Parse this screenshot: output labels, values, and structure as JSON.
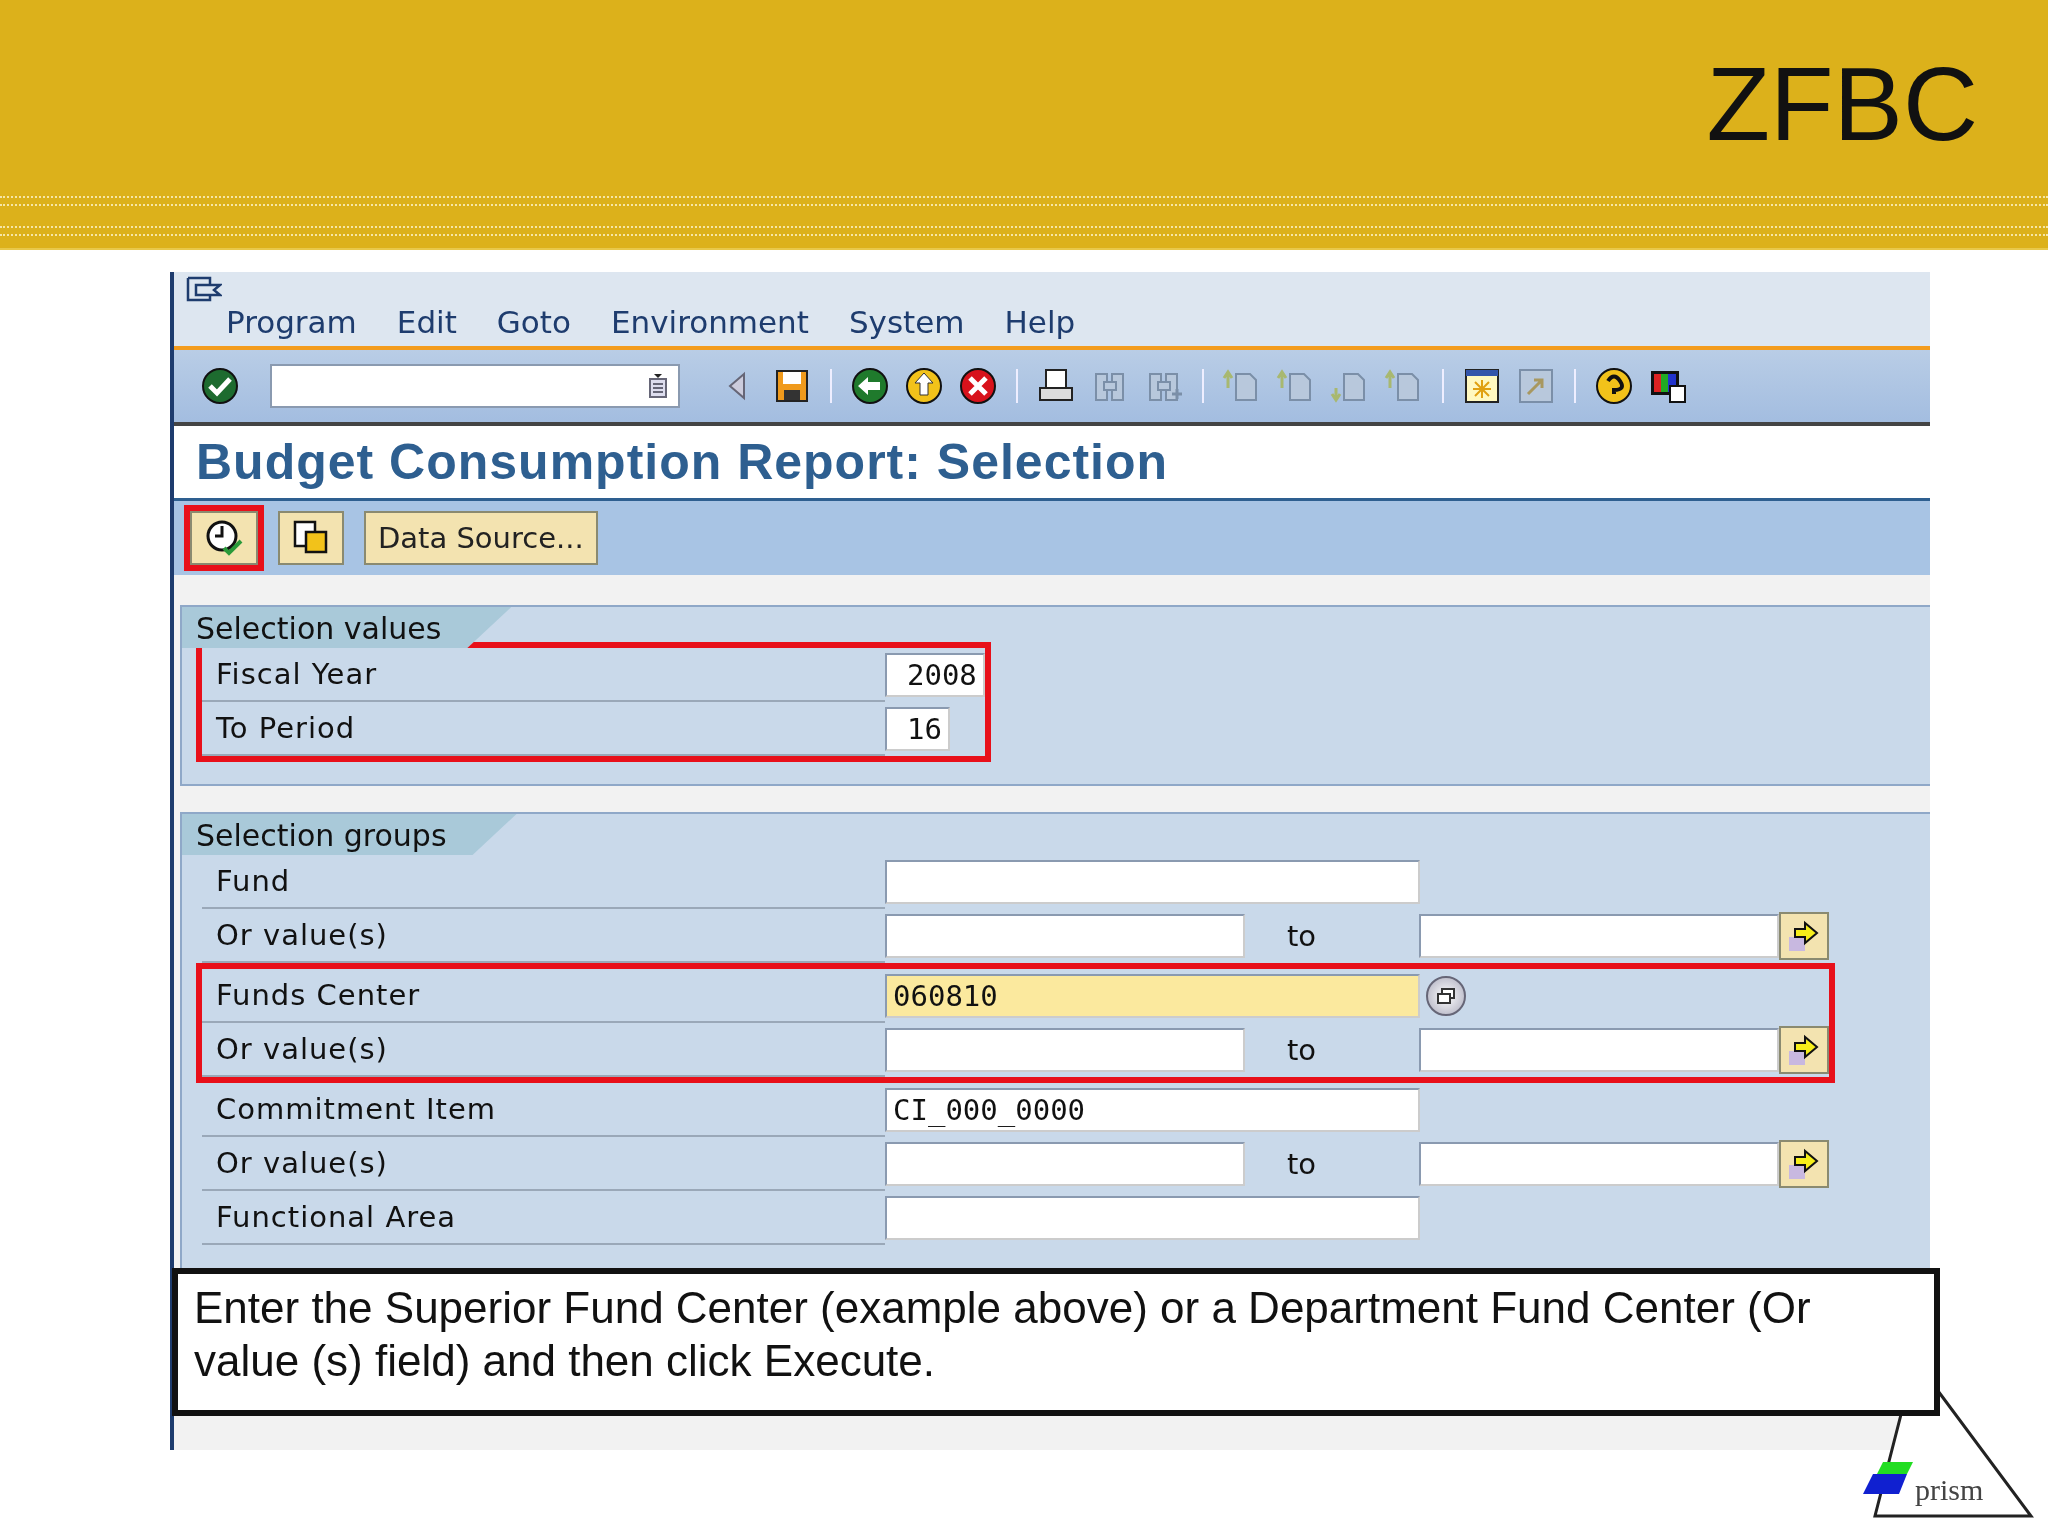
{
  "slide": {
    "title": "ZFBC",
    "caption": "Enter the Superior Fund Center (example above) or a Department Fund Center (Or value (s) field) and then click Execute.",
    "logo": "prism"
  },
  "menu": [
    "Program",
    "Edit",
    "Goto",
    "Environment",
    "System",
    "Help"
  ],
  "screen_title": "Budget Consumption Report: Selection",
  "app_toolbar": [
    {
      "kind": "execute",
      "highlighted": true
    },
    {
      "kind": "variant",
      "highlighted": false
    },
    {
      "kind": "text",
      "label": "Data Source...",
      "highlighted": false
    }
  ],
  "sections": [
    {
      "title": "Selection values",
      "groups": [
        {
          "highlighted": true,
          "rows": [
            {
              "kind": "param",
              "label": "Fiscal Year",
              "value": "2008"
            },
            {
              "kind": "param",
              "label": "To Period",
              "value": "16"
            }
          ]
        }
      ]
    },
    {
      "title": "Selection groups",
      "groups": [
        {
          "highlighted": false,
          "rows": [
            {
              "kind": "single",
              "label": "Fund",
              "value": "",
              "focused": false
            },
            {
              "kind": "range",
              "label": "Or value(s)",
              "to": "to"
            }
          ]
        },
        {
          "highlighted": true,
          "rows": [
            {
              "kind": "single",
              "label": "Funds Center",
              "value": "060810",
              "focused": true
            },
            {
              "kind": "range",
              "label": "Or value(s)",
              "to": "to"
            }
          ]
        },
        {
          "highlighted": false,
          "rows": [
            {
              "kind": "single",
              "label": "Commitment Item",
              "value": "CI_000_0000",
              "focused": false
            },
            {
              "kind": "range",
              "label": "Or value(s)",
              "to": "to"
            },
            {
              "kind": "single",
              "label": "Functional Area",
              "value": "",
              "focused": false
            }
          ]
        }
      ]
    }
  ]
}
